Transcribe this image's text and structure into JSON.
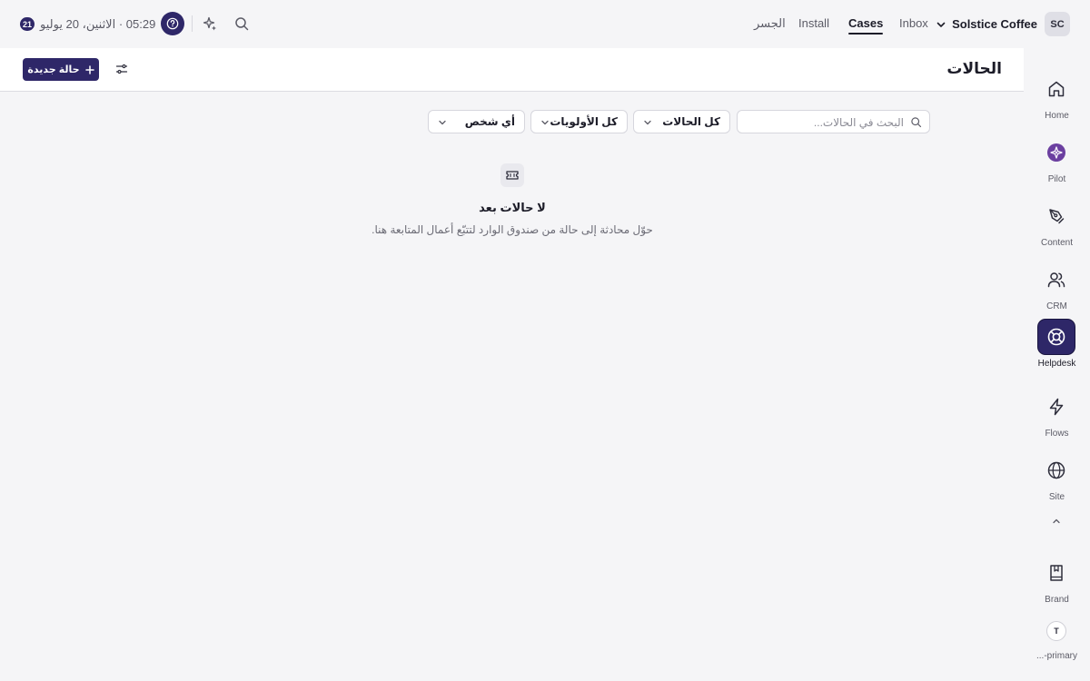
{
  "topbar": {
    "workspace": {
      "initials": "SC",
      "name": "Solstice Coffee"
    },
    "nav": [
      {
        "label": "Inbox",
        "active": false
      },
      {
        "label": "Cases",
        "active": true
      },
      {
        "label": "Install",
        "active": false
      },
      {
        "label": "الجسر",
        "active": false
      }
    ],
    "datetime": "05:29 · الاثنين، 20 يوليو",
    "day_badge": "21"
  },
  "page": {
    "title": "الحالات",
    "new_case_label": "حالة جديدة"
  },
  "filters": {
    "search_placeholder": "البحث في الحالات...",
    "status": "كل الحالات",
    "priority": "كل الأولويات",
    "assignee": "أي شخص"
  },
  "empty_state": {
    "title": "لا حالات بعد",
    "description": "حوّل محادثة إلى حالة من صندوق الوارد لتتبّع أعمال المتابعة هنا."
  },
  "sidebar": {
    "items": [
      {
        "label": "Home",
        "icon": "home-icon",
        "active": false
      },
      {
        "label": "Pilot",
        "icon": "pilot-icon",
        "active": false
      },
      {
        "label": "Content",
        "icon": "pen-icon",
        "active": false
      },
      {
        "label": "CRM",
        "icon": "users-icon",
        "active": false
      },
      {
        "label": "Helpdesk",
        "icon": "lifebuoy-icon",
        "active": true
      },
      {
        "label": "Flows",
        "icon": "bolt-icon",
        "active": false
      },
      {
        "label": "Site",
        "icon": "globe-icon",
        "active": false
      }
    ],
    "brand_label": "Brand",
    "account_initial": "T",
    "account_label": "...-primary"
  },
  "colors": {
    "accent": "#2e2768",
    "pilot": "#6b3fa0",
    "background": "#f5f5f7"
  }
}
